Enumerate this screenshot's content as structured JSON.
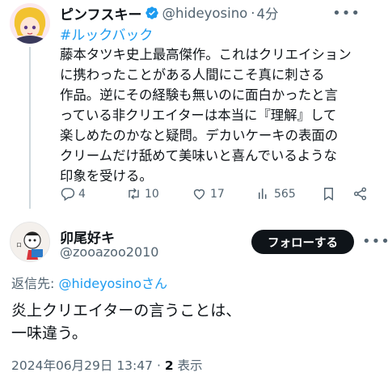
{
  "tweet1": {
    "display_name": "ピンフスキー",
    "handle": "@hideyosino",
    "time": "4分",
    "separator": "·",
    "hashtag": "#ルックバック",
    "body_lines": [
      "藤本タツキ史上最高傑作。これはクリエイション",
      "に携わったことがある人間にこそ真に刺さる",
      "作品。逆にその経験も無いのに面白かったと言",
      "っている非クリエイターは本当に『理解』して",
      "楽しめたのかなと疑問。デカいケーキの表面の",
      "クリームだけ舐めて美味いと喜んでいるような",
      "印象を受ける。"
    ],
    "replies": "4",
    "retweets": "10",
    "likes": "17",
    "views": "565"
  },
  "tweet2": {
    "display_name": "卯尾好キ",
    "handle": "@zooazoo2010",
    "follow_label": "フォローする",
    "reply_prefix": "返信先: ",
    "reply_handle": "@hideyosino",
    "reply_suffix": "さん",
    "body_lines": [
      "炎上クリエイターの言うことは、",
      "一味違う。"
    ],
    "date": "2024年06月29日 13:47",
    "separator": "·",
    "view_count": "2",
    "view_label": " 表示"
  },
  "colors": {
    "accent": "#1d9bf0",
    "text": "#0f1419",
    "muted": "#536471",
    "verified": "#1d9bf0"
  },
  "icons": [
    "verified-badge-icon",
    "more-options-icon",
    "reply-icon",
    "retweet-icon",
    "like-icon",
    "views-icon",
    "bookmark-icon",
    "share-icon"
  ]
}
